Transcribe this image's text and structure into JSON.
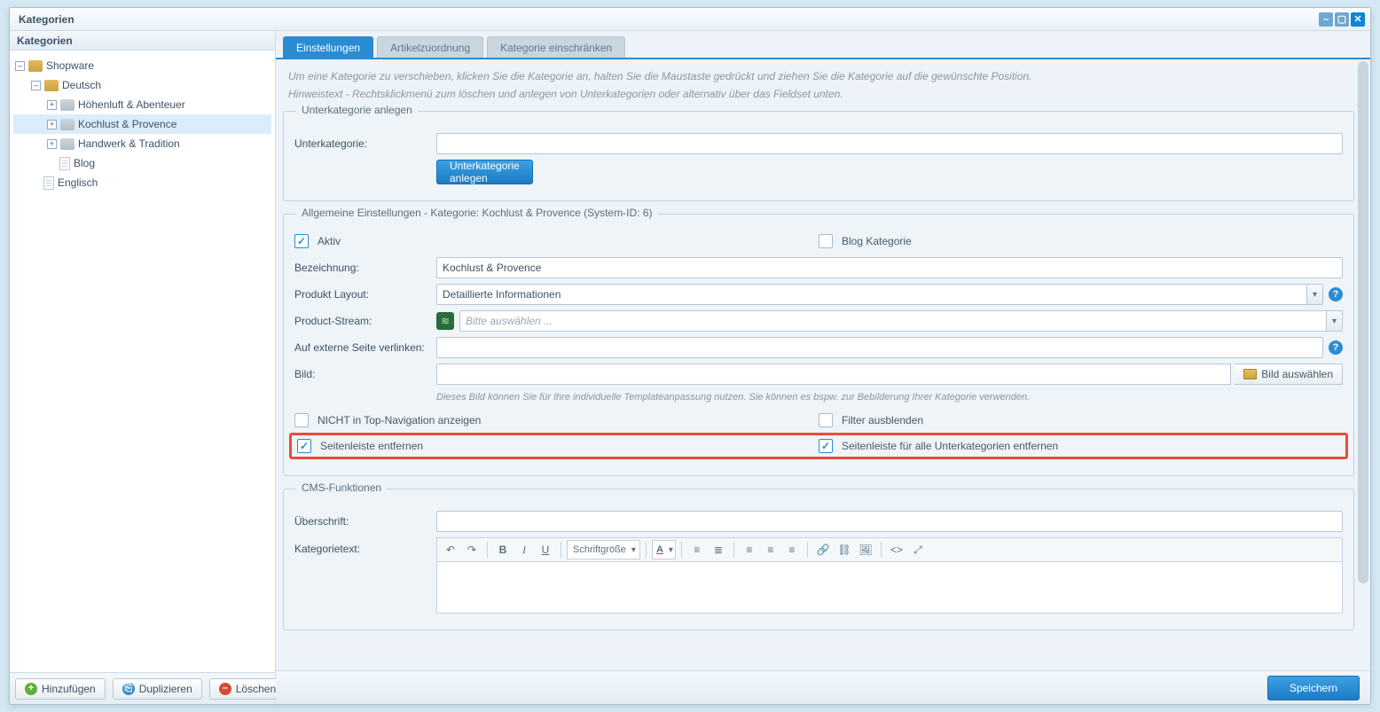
{
  "window": {
    "title": "Kategorien"
  },
  "sidebar": {
    "heading": "Kategorien",
    "tree": {
      "root": "Shopware",
      "children": [
        {
          "label": "Deutsch",
          "expanded": true,
          "children": [
            {
              "label": "Höhenluft & Abenteuer"
            },
            {
              "label": "Kochlust & Provence",
              "selected": true
            },
            {
              "label": "Handwerk & Tradition"
            },
            {
              "label": "Blog",
              "leaf": true
            }
          ]
        },
        {
          "label": "Englisch",
          "leaf": true
        }
      ]
    },
    "buttons": {
      "add": "Hinzufügen",
      "duplicate": "Duplizieren",
      "delete": "Löschen"
    }
  },
  "tabs": [
    {
      "label": "Einstellungen",
      "active": true
    },
    {
      "label": "Artikelzuordnung"
    },
    {
      "label": "Kategorie einschränken"
    }
  ],
  "hints": {
    "move": "Um eine Kategorie zu verschieben, klicken Sie die Kategorie an, halten Sie die Maustaste gedrückt und ziehen Sie die Kategorie auf die gewünschte Position.",
    "context": "Hinweistext - Rechtsklickmenü zum löschen und anlegen von Unterkategorien oder alternativ über das Fieldset unten."
  },
  "subcat": {
    "legend": "Unterkategorie anlegen",
    "label": "Unterkategorie:",
    "button": "Unterkategorie anlegen"
  },
  "general": {
    "legend": "Allgemeine Einstellungen - Kategorie: Kochlust & Provence (System-ID: 6)",
    "active_label": "Aktiv",
    "blog_label": "Blog Kategorie",
    "name_label": "Bezeichnung:",
    "name_value": "Kochlust & Provence",
    "layout_label": "Produkt Layout:",
    "layout_value": "Detaillierte Informationen",
    "stream_label": "Product-Stream:",
    "stream_placeholder": "Bitte auswählen ...",
    "link_label": "Auf externe Seite verlinken:",
    "image_label": "Bild:",
    "image_button": "Bild auswählen",
    "image_hint": "Dieses Bild können Sie für Ihre individuelle Templateanpassung nutzen. Sie können es bspw. zur Bebilderung Ihrer Kategorie verwenden.",
    "notop_label": "NICHT in Top-Navigation anzeigen",
    "hidefilter_label": "Filter ausblenden",
    "removesidebar_label": "Seitenleiste entfernen",
    "removesidebar_sub_label": "Seitenleiste für alle Unterkategorien entfernen"
  },
  "cms": {
    "legend": "CMS-Funktionen",
    "headline_label": "Überschrift:",
    "text_label": "Kategorietext:",
    "fontsize": "Schriftgröße"
  },
  "footer": {
    "save": "Speichern"
  }
}
